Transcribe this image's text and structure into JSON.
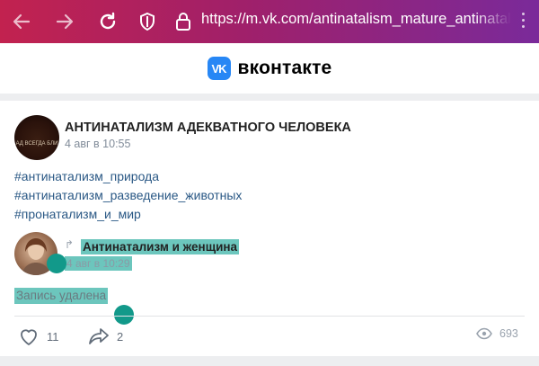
{
  "browser": {
    "url": "https://m.vk.com/antinatalism_mature_antinatalist",
    "icons": [
      "back-arrow-icon",
      "forward-arrow-icon",
      "reload-icon",
      "shield-icon",
      "lock-icon",
      "menu-dots-icon"
    ]
  },
  "header": {
    "brand": "вконтакте",
    "logo_text": "VK"
  },
  "post": {
    "group_name": "АНТИНАТАЛИЗМ АДЕКВАТНОГО ЧЕЛОВЕКА",
    "avatar_caption": "АД ВСЕГДА БЛИ",
    "time": "4 авг в 10:55",
    "hashtags": [
      "#антинатализм_природа",
      "#антинатализм_разведение_животных",
      "#пронатализм_и_мир"
    ],
    "repost": {
      "author": "Антинатализм и женщина",
      "time": "4 авг в 10:29",
      "text": "Запись удалена"
    },
    "actions": {
      "likes": "11",
      "shares": "2",
      "views": "693"
    }
  },
  "colors": {
    "toolbar_start": "#c2224f",
    "toolbar_end": "#7a2a9a",
    "link": "#2a5885",
    "selection": "#6cc6bd",
    "handle": "#12998a",
    "vk_blue": "#2787f5"
  }
}
